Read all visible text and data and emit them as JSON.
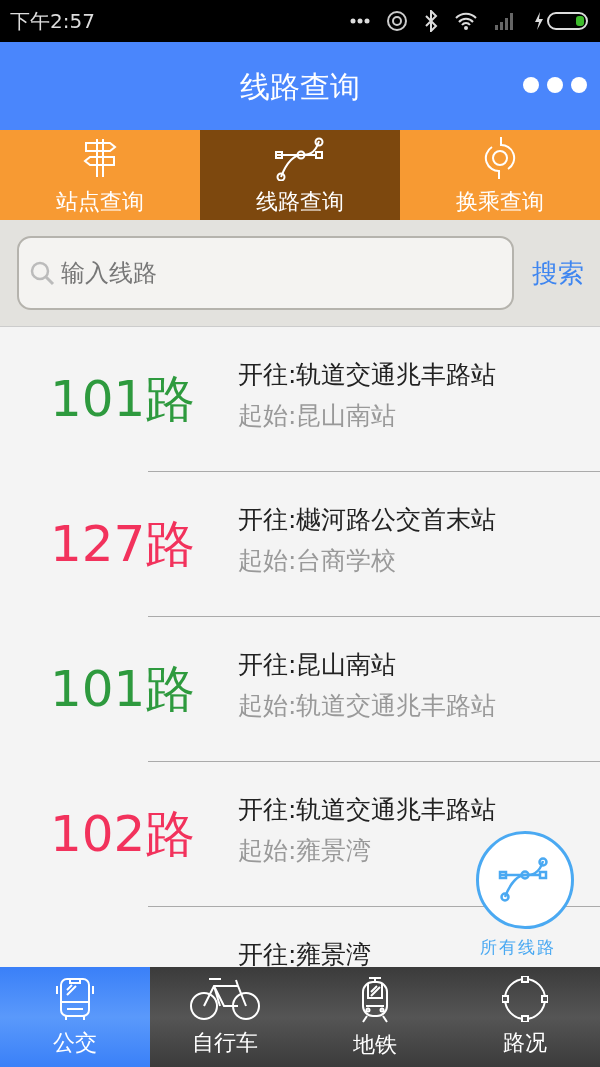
{
  "status_bar": {
    "time": "下午2:57"
  },
  "header": {
    "title": "线路查询"
  },
  "tabs": [
    {
      "label": "站点查询",
      "selected": false,
      "kind": "signpost"
    },
    {
      "label": "线路查询",
      "selected": true,
      "kind": "route"
    },
    {
      "label": "换乘查询",
      "selected": false,
      "kind": "transfer"
    }
  ],
  "search": {
    "placeholder": "输入线路",
    "button": "搜索"
  },
  "routes": [
    {
      "number": "101路",
      "color": "#2e9a3e",
      "destination": "开往:轨道交通兆丰路站",
      "origin": "起始:昆山南站"
    },
    {
      "number": "127路",
      "color": "#f2325c",
      "destination": "开往:樾河路公交首末站",
      "origin": "起始:台商学校"
    },
    {
      "number": "101路",
      "color": "#2e9a3e",
      "destination": "开往:昆山南站",
      "origin": "起始:轨道交通兆丰路站"
    },
    {
      "number": "102路",
      "color": "#f2325c",
      "destination": "开往:轨道交通兆丰路站",
      "origin": "起始:雍景湾"
    },
    {
      "destination": "开往:雍景湾"
    }
  ],
  "fab": {
    "label": "所有线路"
  },
  "bottom_nav": [
    {
      "label": "公交",
      "selected": true,
      "kind": "bus"
    },
    {
      "label": "自行车",
      "selected": false,
      "kind": "bike"
    },
    {
      "label": "地铁",
      "selected": false,
      "kind": "metro"
    },
    {
      "label": "路况",
      "selected": false,
      "kind": "traffic"
    }
  ]
}
